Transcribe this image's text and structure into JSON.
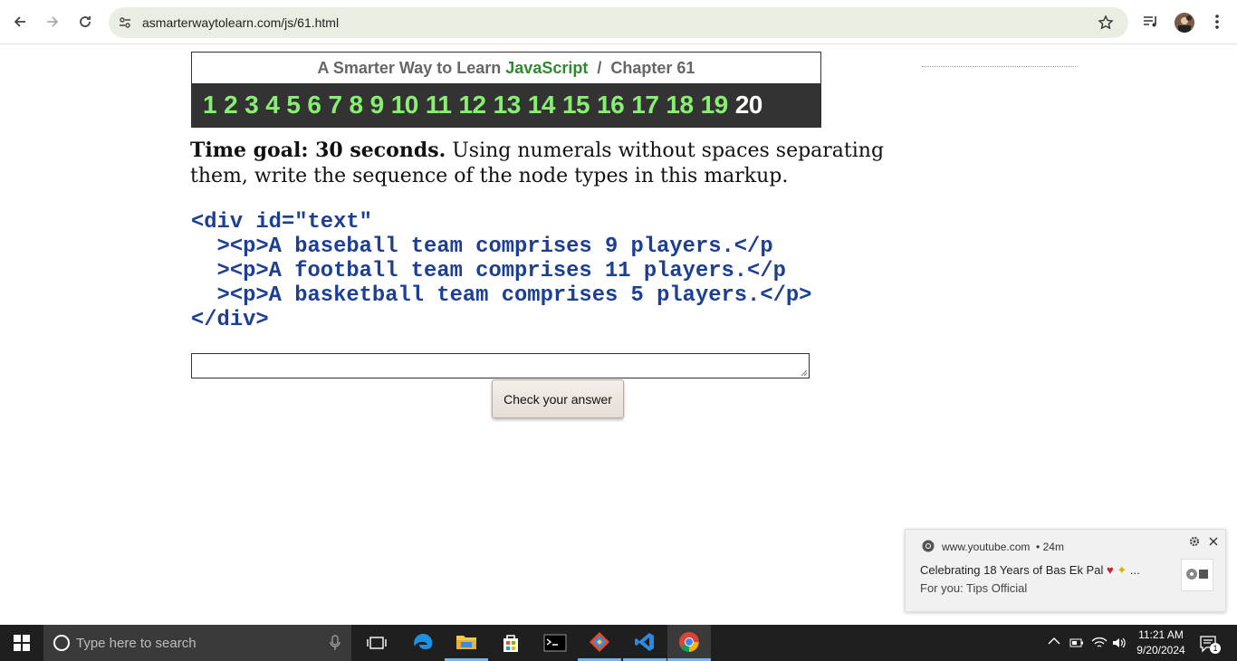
{
  "browser": {
    "url": "asmarterwaytolearn.com/js/61.html"
  },
  "header": {
    "title_prefix": "A Smarter Way to Learn ",
    "title_js": "JavaScript",
    "title_sep": "/",
    "title_chapter": "Chapter 61",
    "chapters": [
      "1",
      "2",
      "3",
      "4",
      "5",
      "6",
      "7",
      "8",
      "9",
      "10",
      "11",
      "12",
      "13",
      "14",
      "15",
      "16",
      "17",
      "18",
      "19",
      "20"
    ],
    "current_chapter": "20"
  },
  "question": {
    "goal": "Time goal: 30 seconds.",
    "text": " Using numerals without spaces separating them, write the sequence of the node types in this markup."
  },
  "code": {
    "lines": [
      "<div id=\"text\"",
      "  ><p>A baseball team comprises 9 players.</p",
      "  ><p>A football team comprises 11 players.</p",
      "  ><p>A basketball team comprises 5 players.</p>",
      "</div>"
    ]
  },
  "answer": {
    "value": "",
    "button_label": "Check your answer"
  },
  "notification": {
    "source": "www.youtube.com",
    "time": "24m",
    "title": "Celebrating 18 Years of Bas Ek Pal",
    "body": "For you: Tips Official"
  },
  "taskbar": {
    "search_placeholder": "Type here to search",
    "time": "11:21 AM",
    "date": "9/20/2024",
    "notification_count": "1"
  }
}
